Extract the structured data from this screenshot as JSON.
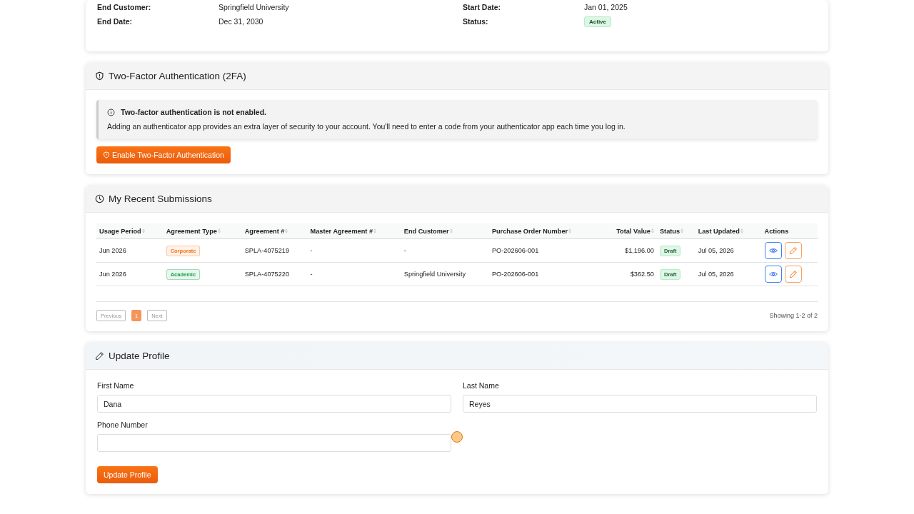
{
  "details": {
    "rows": [
      {
        "left": {
          "label": "End Customer:",
          "value": "Springfield University"
        },
        "right": {
          "label": "Start Date:",
          "value": "Jan 01, 2025",
          "kind": "text"
        }
      },
      {
        "left": {
          "label": "End Date:",
          "value": "Dec 31, 2030"
        },
        "right": {
          "label": "Status:",
          "value": "Active",
          "kind": "badge"
        }
      }
    ]
  },
  "two_factor": {
    "title": "Two-Factor Authentication (2FA)",
    "alert": {
      "title": "Two-factor authentication is not enabled.",
      "text": "Adding an authenticator app provides an extra layer of security to your account. You'll need to enter a code from your authenticator app each time you log in."
    },
    "button": "Enable Two-Factor Authentication"
  },
  "submissions": {
    "title": "My Recent Submissions",
    "table": {
      "columns": [
        {
          "label": "Usage Period",
          "sortable": true
        },
        {
          "label": "Agreement Type",
          "sortable": true
        },
        {
          "label": "Agreement #",
          "sortable": true
        },
        {
          "label": "Master Agreement #",
          "sortable": true
        },
        {
          "label": "End Customer",
          "sortable": true
        },
        {
          "label": "Purchase Order Number",
          "sortable": true
        },
        {
          "label": "Total Value",
          "sortable": true
        },
        {
          "label": "Status",
          "sortable": true
        },
        {
          "label": "Last Updated",
          "sortable": true
        },
        {
          "label": "Actions",
          "sortable": false
        }
      ],
      "rows": [
        {
          "usage_period": "Jun 2026",
          "agreement_type": {
            "label": "Corporate",
            "color": "#f97316"
          },
          "agreement_no": "SPLA-4075219",
          "master_agreement_no": "-",
          "end_customer": "-",
          "po_number": "PO-202606-001",
          "total_value": "$1,196.00",
          "status": "Draft",
          "last_updated": "Jul 05, 2026"
        },
        {
          "usage_period": "Jun 2026",
          "agreement_type": {
            "label": "Academic",
            "color": "#16a34a"
          },
          "agreement_no": "SPLA-4075220",
          "master_agreement_no": "-",
          "end_customer": "Springfield University",
          "po_number": "PO-202606-001",
          "total_value": "$362.50",
          "status": "Draft",
          "last_updated": "Jul 05, 2026"
        }
      ]
    },
    "pagination": {
      "previous": {
        "label": "Previous",
        "disabled": true
      },
      "pages": [
        {
          "label": "1",
          "selected": true
        }
      ],
      "next": {
        "label": "Next",
        "disabled": true
      }
    },
    "summary": "Showing 1-2 of 2"
  },
  "profile": {
    "title": "Update Profile",
    "fields": [
      {
        "label": "First Name",
        "value": "Dana"
      },
      {
        "label": "Last Name",
        "value": "Reyes"
      },
      {
        "label": "Phone Number"
      }
    ],
    "button": "Update Profile"
  }
}
